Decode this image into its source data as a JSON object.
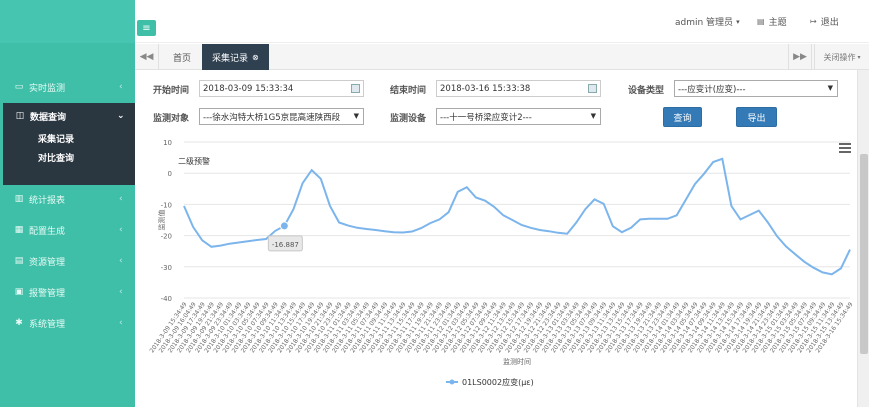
{
  "sidebar": {
    "items": [
      {
        "label": "实时监测",
        "icon": "monitor-icon"
      },
      {
        "label": "数据查询",
        "icon": "table-icon"
      },
      {
        "label": "统计报表",
        "icon": "bar-chart-icon"
      },
      {
        "label": "配置生成",
        "icon": "grid-icon"
      },
      {
        "label": "资源管理",
        "icon": "folder-icon"
      },
      {
        "label": "报警管理",
        "icon": "alarm-icon"
      },
      {
        "label": "系统管理",
        "icon": "gear-icon"
      }
    ],
    "active_sub": [
      "采集记录",
      "对比查询"
    ]
  },
  "header": {
    "user": "admin 管理员",
    "theme": "主题",
    "logout": "退出"
  },
  "tabs": {
    "items": [
      "首页",
      "采集记录"
    ],
    "active": "采集记录",
    "close_ops": "关闭操作"
  },
  "filters": {
    "start_label": "开始时间",
    "start_value": "2018-03-09 15:33:34",
    "end_label": "结束时间",
    "end_value": "2018-03-16 15:33:38",
    "type_label": "设备类型",
    "type_value": "---应变计(应变)---",
    "object_label": "监测对象",
    "object_value": "---徐水沟特大桥1G5京昆高速陕西段",
    "device_label": "监测设备",
    "device_value": "---十一号桥梁应变计2---",
    "query_button": "查询",
    "export_button": "导出"
  },
  "chart_data": {
    "type": "line",
    "title": "二级预警",
    "xlabel": "监测时间",
    "ylabel": "监测值",
    "ylim": [
      -40,
      10
    ],
    "yticks": [
      10,
      0,
      -10,
      -20,
      -30,
      -40
    ],
    "tooltip": "-16.887",
    "series": [
      {
        "name": "01LS0002应变(με)",
        "color": "#7cb5ec",
        "values": [
          -10.5,
          -17.2,
          -21.5,
          -23.6,
          -23.2,
          -22.6,
          -22.2,
          -21.8,
          -21.4,
          -21.1,
          -18.5,
          -16.9,
          -11.5,
          -3.2,
          1.0,
          -1.8,
          -10.5,
          -15.8,
          -16.8,
          -17.5,
          -17.9,
          -18.2,
          -18.6,
          -18.9,
          -19.0,
          -18.7,
          -17.6,
          -16.0,
          -14.8,
          -12.5,
          -6.0,
          -4.5,
          -7.8,
          -8.8,
          -10.8,
          -13.5,
          -15.0,
          -16.6,
          -17.5,
          -18.2,
          -18.6,
          -19.1,
          -19.4,
          -15.8,
          -11.5,
          -8.4,
          -9.8,
          -17.0,
          -18.9,
          -17.5,
          -14.8,
          -14.6,
          -14.6,
          -14.6,
          -13.5,
          -8.5,
          -3.5,
          -0.2,
          3.6,
          4.6,
          -10.5,
          -14.8,
          -13.4,
          -12.0,
          -15.8,
          -20.2,
          -23.5,
          -26.0,
          -28.4,
          -30.3,
          -31.8,
          -32.4,
          -30.5,
          -24.5
        ]
      },
      {
        "name": "二级预警",
        "values": []
      }
    ],
    "x_categories": [
      "2018-3-09 15:34:49",
      "2018-3-09 16:04:49",
      "2018-3-09 17:34:49",
      "2018-3-09 19:34:49",
      "2018-3-09 21:34:49",
      "2018-3-09 23:34:49",
      "2018-3-10 01:34:49",
      "2018-3-10 03:34:49",
      "2018-3-10 05:34:49",
      "2018-3-10 07:34:49",
      "2018-3-10 09:34:49",
      "2018-3-10 11:34:49",
      "2018-3-10 13:34:49",
      "2018-3-10 15:34:49",
      "2018-3-10 17:34:49",
      "2018-3-10 19:34:49",
      "2018-3-10 21:34:49",
      "2018-3-10 23:34:49",
      "2018-3-11 01:34:49",
      "2018-3-11 03:34:49",
      "2018-3-11 05:34:49",
      "2018-3-11 07:34:49",
      "2018-3-11 09:34:49",
      "2018-3-11 11:34:49",
      "2018-3-11 13:34:49",
      "2018-3-11 15:34:49",
      "2018-3-11 17:34:49",
      "2018-3-11 19:34:49",
      "2018-3-11 21:34:49",
      "2018-3-11 23:34:49",
      "2018-3-12 01:34:49",
      "2018-3-12 03:34:49",
      "2018-3-12 05:34:49",
      "2018-3-12 07:34:49",
      "2018-3-12 09:34:49",
      "2018-3-12 11:34:49",
      "2018-3-12 13:34:49",
      "2018-3-12 15:34:49",
      "2018-3-12 17:34:49",
      "2018-3-12 19:34:49",
      "2018-3-12 21:34:49",
      "2018-3-12 23:34:49",
      "2018-3-13 01:34:49",
      "2018-3-13 03:34:49",
      "2018-3-13 05:34:49",
      "2018-3-13 07:34:49",
      "2018-3-13 09:34:49",
      "2018-3-13 11:34:49",
      "2018-3-13 13:34:49",
      "2018-3-13 15:34:49",
      "2018-3-13 17:34:49",
      "2018-3-13 19:34:49",
      "2018-3-13 21:34:49",
      "2018-3-13 23:34:49",
      "2018-3-14 01:34:49",
      "2018-3-14 03:34:49",
      "2018-3-14 05:34:49",
      "2018-3-14 07:34:49",
      "2018-3-14 09:34:49",
      "2018-3-14 11:34:49",
      "2018-3-14 13:34:49",
      "2018-3-14 15:34:49",
      "2018-3-14 17:34:49",
      "2018-3-14 19:34:49",
      "2018-3-14 21:34:49",
      "2018-3-14 23:34:49",
      "2018-3-15 01:34:49",
      "2018-3-15 03:34:49",
      "2018-3-15 05:34:49",
      "2018-3-15 07:34:49",
      "2018-3-15 09:34:49",
      "2018-3-15 11:34:49",
      "2018-3-15 13:34:49",
      "2018-3-16 15:34:49"
    ],
    "legend": "bottom-center",
    "grid": true
  },
  "colors": {
    "sidebar": "#3fbfa8",
    "active_menu": "#2b3740",
    "active_tab": "#2f4050",
    "button": "#337ab7",
    "series": "#7cb5ec"
  }
}
